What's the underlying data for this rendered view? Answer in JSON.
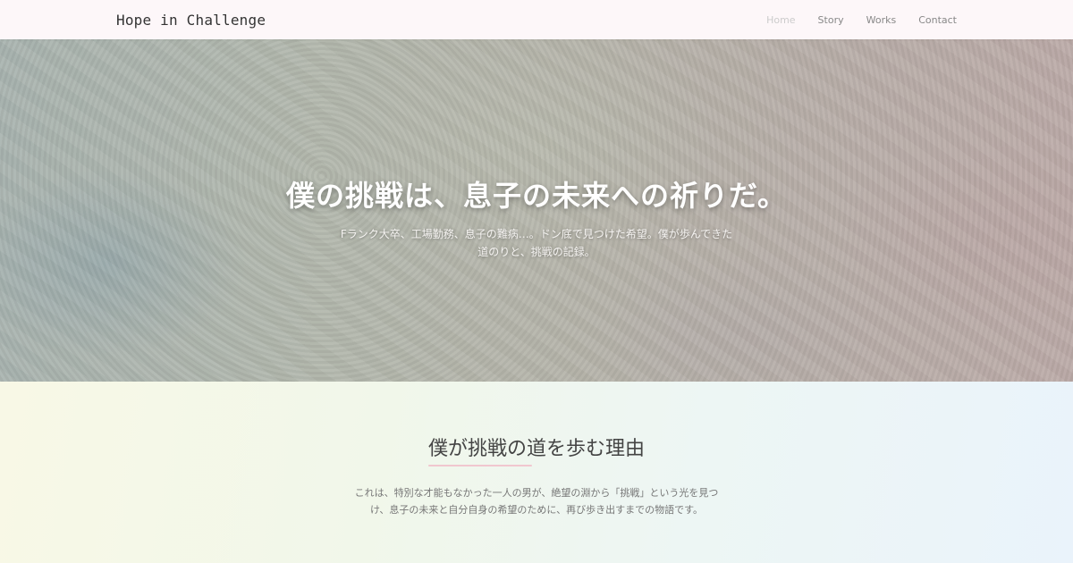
{
  "nav": {
    "brand": "Hope in Challenge",
    "links": [
      {
        "label": "Home",
        "active": true
      },
      {
        "label": "Story",
        "active": false
      },
      {
        "label": "Works",
        "active": false
      },
      {
        "label": "Contact",
        "active": false
      }
    ]
  },
  "hero": {
    "title": "僕の挑戦は、息子の未来への祈りだ。",
    "subtitle": "Fランク大卒、工場勤務、息子の難病…。ドン底で見つけた希望。僕が歩んできた道のりと、挑戦の記録。"
  },
  "section": {
    "title": "僕が挑戦の道を歩む理由",
    "body": "これは、特別な才能もなかった一人の男が、絶望の淵から「挑戦」という光を見つけ、息子の未来と自分自身の希望のために、再び歩き出すまでの物語です。"
  },
  "colors": {
    "nav_background": "#fdf7f9",
    "accent_underline": "#f1c7cf",
    "hero_title": "#ffffff"
  }
}
